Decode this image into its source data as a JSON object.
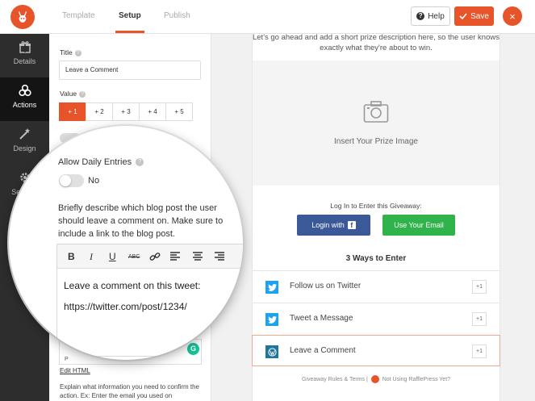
{
  "header": {
    "tabs": [
      {
        "label": "Template"
      },
      {
        "label": "Setup"
      },
      {
        "label": "Publish"
      }
    ],
    "help_label": "Help",
    "save_label": "Save",
    "close_label": "×"
  },
  "sidebar": {
    "items": [
      {
        "label": "Details",
        "icon": "gift-icon"
      },
      {
        "label": "Actions",
        "icon": "actions-icon"
      },
      {
        "label": "Design",
        "icon": "design-icon"
      },
      {
        "label": "Settings",
        "icon": "gear-icon"
      }
    ]
  },
  "settings": {
    "title_label": "Title",
    "title_value": "Leave a Comment",
    "value_label": "Value",
    "value_options": [
      "+ 1",
      "+ 2",
      "+ 3",
      "+ 4",
      "+ 5"
    ],
    "selected_value": "+ 1",
    "mandatory_no": "No",
    "allow_daily_label": "Allow Daily Entries",
    "allow_daily_value": "No",
    "instructions": "Briefly describe which blog post the user should leave a comment on. Make sure to include a link to the blog post.",
    "editor_line1": "Leave a comment on this tweet:",
    "editor_line2": "https://twitter.com/post/1234/",
    "editor_path": "P",
    "edit_html": "Edit HTML",
    "explain_text": "Explain what information you need to confirm the action. Ex: Enter the email you used on"
  },
  "preview": {
    "description": "Let's go ahead and add a short prize description here, so the user knows exactly what they're about to win.",
    "prize_image_label": "Insert Your Prize Image",
    "login_label": "Log In to Enter this Giveaway:",
    "facebook_button": "Login with",
    "email_button": "Use Your Email",
    "ways_title": "3 Ways to Enter",
    "entries": [
      {
        "label": "Follow us on Twitter",
        "points": "+1",
        "icon": "twitter-icon"
      },
      {
        "label": "Tweet a Message",
        "points": "+1",
        "icon": "twitter-icon"
      },
      {
        "label": "Leave a Comment",
        "points": "+1",
        "icon": "wordpress-icon"
      }
    ],
    "footer_rules": "Giveaway Rules & Terms",
    "footer_sep": "|",
    "footer_cta": "Not Using RafflePress Yet?"
  },
  "colors": {
    "accent": "#e8542a",
    "facebook": "#3b5998",
    "email": "#2fb34a",
    "twitter": "#1da1f2",
    "wordpress": "#21759b"
  }
}
